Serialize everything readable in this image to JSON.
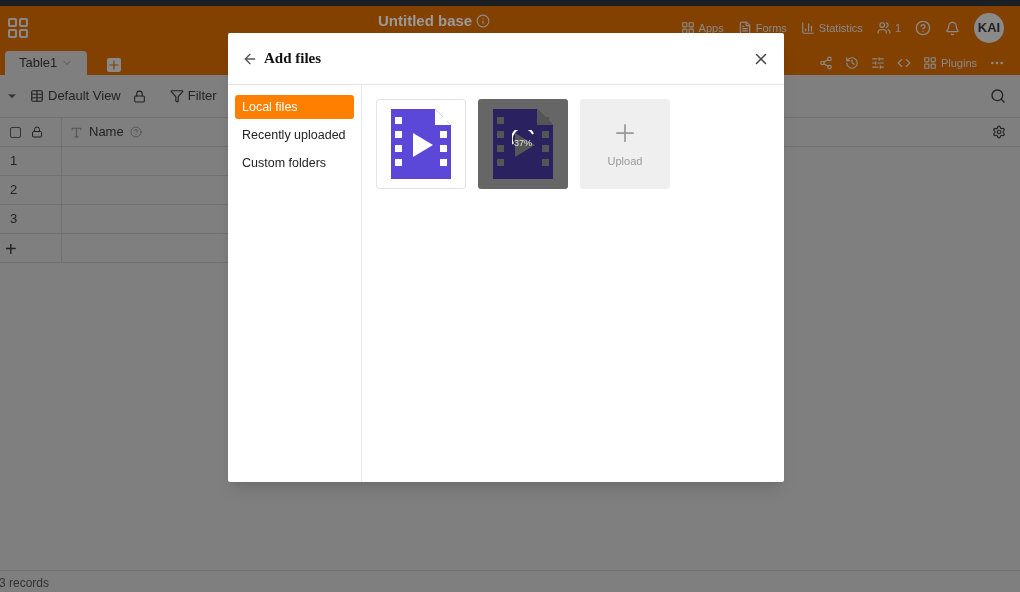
{
  "header": {
    "title": "Untitled base",
    "actions": [
      {
        "kind": "apps",
        "label": "Apps"
      },
      {
        "kind": "forms",
        "label": "Forms"
      },
      {
        "kind": "statistics",
        "label": "Statistics"
      },
      {
        "kind": "users",
        "label": "1"
      }
    ],
    "avatar": "KAI"
  },
  "tabs": [
    {
      "label": "Table1",
      "selected": true
    }
  ],
  "toolbar": {
    "view": "Default View",
    "filter": "Filter",
    "plugins": "Plugins"
  },
  "table": {
    "select_all": {
      "checked": false
    },
    "columns": [
      {
        "label": "Name"
      }
    ],
    "rows": [
      "1",
      "2",
      "3"
    ],
    "add_row": "+"
  },
  "status_bar": "3 records",
  "dialog": {
    "title": "Add files",
    "nav": [
      {
        "label": "Local files",
        "selected": true
      },
      {
        "label": "Recently uploaded",
        "selected": false
      },
      {
        "label": "Custom folders",
        "selected": false
      }
    ],
    "files": [
      {
        "kind": "video",
        "uploading": false
      },
      {
        "kind": "video",
        "uploading": true,
        "progress": "37%"
      },
      {
        "kind": "upload",
        "label": "Upload"
      }
    ]
  }
}
